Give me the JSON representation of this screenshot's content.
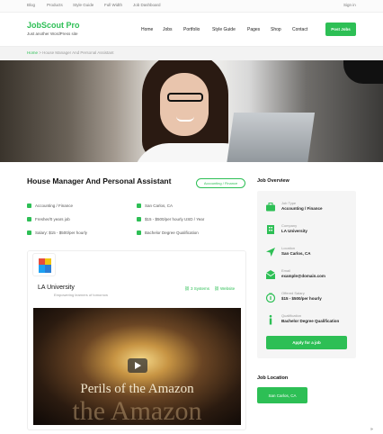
{
  "topbar": {
    "links": [
      "Blog",
      "Products",
      "Style Guide",
      "Full Width",
      "Job Dashboard"
    ],
    "signin": "Sign in"
  },
  "header": {
    "logo": "JobScout Pro",
    "tagline": "Just another WordPress site",
    "nav": [
      "Home",
      "Jobs",
      "Portfolio",
      "Style Guide",
      "Pages",
      "Shop",
      "Contact"
    ],
    "post_button": "Post Jobs"
  },
  "breadcrumb": {
    "home": "Home",
    "separator": " > ",
    "current": "House Manager And Personal Assistant"
  },
  "job": {
    "title": "House Manager And Personal Assistant",
    "category_badge": "Accounting / Finance",
    "meta": {
      "category": "Accounting / Finance",
      "location": "San Carlos, CA",
      "experience": "Fresher/0 years job",
      "salary_range": "$15 - $500/per hourly USD / Year",
      "salary": "Salary: $15 - $500/per hourly",
      "qualification": "Bachelor Degree Qualification"
    }
  },
  "company": {
    "name": "LA University",
    "subtitle": "Empowering learners of tomorrow",
    "links": [
      "3 Systems",
      "Website"
    ]
  },
  "video": {
    "title_line1": "Perils of the Amazon",
    "title_line2": "the Amazon"
  },
  "overview": {
    "title": "Job Overview",
    "items": [
      {
        "label": "Job Type",
        "value": "Accounting / Finance",
        "icon": "briefcase-icon"
      },
      {
        "label": "Company",
        "value": "LA University",
        "icon": "building-icon"
      },
      {
        "label": "Location",
        "value": "San Carlos, CA",
        "icon": "location-arrow-icon"
      },
      {
        "label": "Email",
        "value": "example@domain.com",
        "icon": "envelope-icon"
      },
      {
        "label": "Offered Salary",
        "value": "$15 - $500/per hourly",
        "icon": "money-icon"
      },
      {
        "label": "Qualification",
        "value": "Bachelor Degree Qualification",
        "icon": "info-icon"
      }
    ],
    "apply_button": "Apply for a job"
  },
  "location_section": {
    "title": "Job Location",
    "button": "San Carlos, CA"
  },
  "scroll_top": "»",
  "colors": {
    "accent": "#2dbf55"
  }
}
